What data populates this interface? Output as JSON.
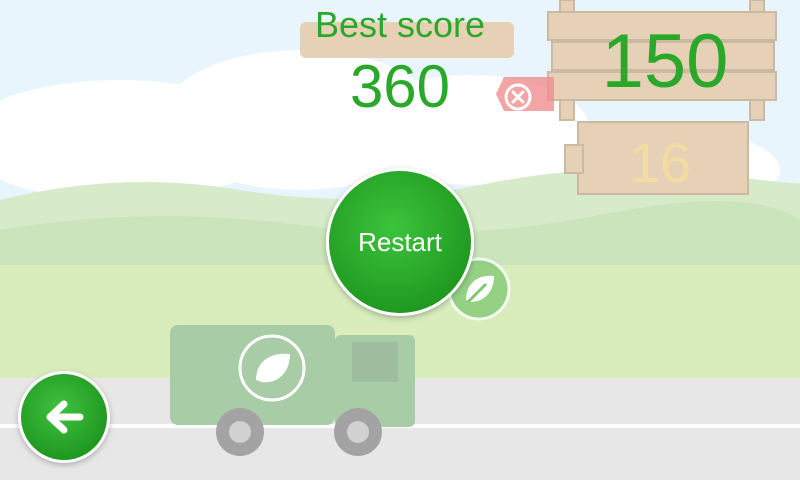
{
  "best": {
    "label": "Best score",
    "value": "360"
  },
  "score": {
    "value": "150"
  },
  "sub_score": {
    "value": "16"
  },
  "restart": {
    "label": "Restart"
  },
  "colors": {
    "accent": "#2aa82a",
    "sub_score": "#f3dca2",
    "button_green": "#28ad28"
  },
  "icons": {
    "back": "arrow-left-icon",
    "close": "close-circle-icon",
    "leaf": "leaf-icon"
  }
}
